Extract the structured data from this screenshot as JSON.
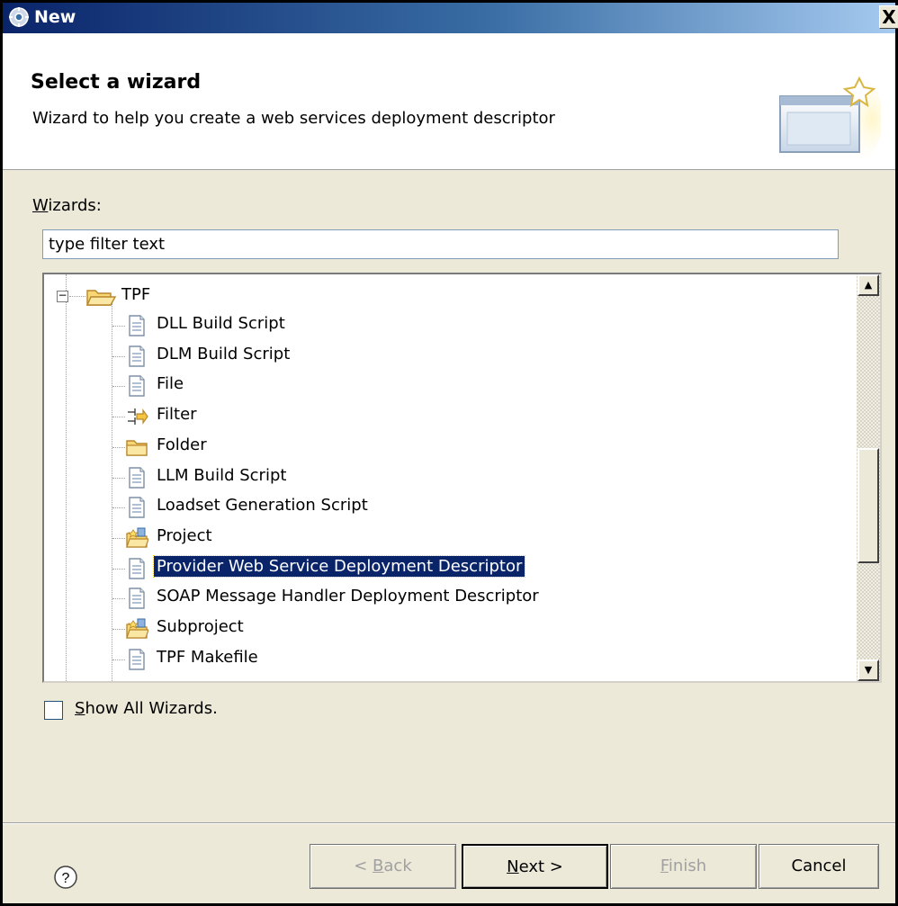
{
  "window": {
    "title": "New",
    "close_glyph": "X",
    "app_icon": "gear-icon"
  },
  "header": {
    "heading": "Select a wizard",
    "description": "Wizard to help you create a web services deployment descriptor",
    "banner_icon": "wizard-banner-icon"
  },
  "wizards": {
    "label_accel": "W",
    "label_rest": "izards:",
    "filter_placeholder": "type filter text",
    "tree": {
      "root": {
        "label": "TPF",
        "icon": "open-folder-icon",
        "expanded": true
      },
      "items": [
        {
          "label": "DLL Build Script",
          "icon": "file-icon"
        },
        {
          "label": "DLM Build Script",
          "icon": "file-icon"
        },
        {
          "label": "File",
          "icon": "file-icon"
        },
        {
          "label": "Filter",
          "icon": "filter-icon"
        },
        {
          "label": "Folder",
          "icon": "folder-icon"
        },
        {
          "label": "LLM Build Script",
          "icon": "file-icon"
        },
        {
          "label": "Loadset Generation Script",
          "icon": "file-icon"
        },
        {
          "label": "Project",
          "icon": "project-icon"
        },
        {
          "label": "Provider Web Service Deployment Descriptor",
          "icon": "file-icon",
          "selected": true
        },
        {
          "label": "SOAP Message Handler Deployment Descriptor",
          "icon": "file-icon"
        },
        {
          "label": "Subproject",
          "icon": "project-icon"
        },
        {
          "label": "TPF Makefile",
          "icon": "file-icon"
        }
      ]
    }
  },
  "show_all": {
    "accel": "S",
    "rest": "how All Wizards.",
    "checked": false
  },
  "buttons": {
    "help_glyph": "?",
    "back": {
      "pre": "< ",
      "accel": "B",
      "rest": "ack",
      "enabled": false
    },
    "next": {
      "pre": "",
      "accel": "N",
      "rest": "ext >",
      "enabled": true
    },
    "finish": {
      "pre": "",
      "accel": "F",
      "rest": "inish",
      "enabled": false
    },
    "cancel": {
      "label": "Cancel",
      "enabled": true
    }
  }
}
